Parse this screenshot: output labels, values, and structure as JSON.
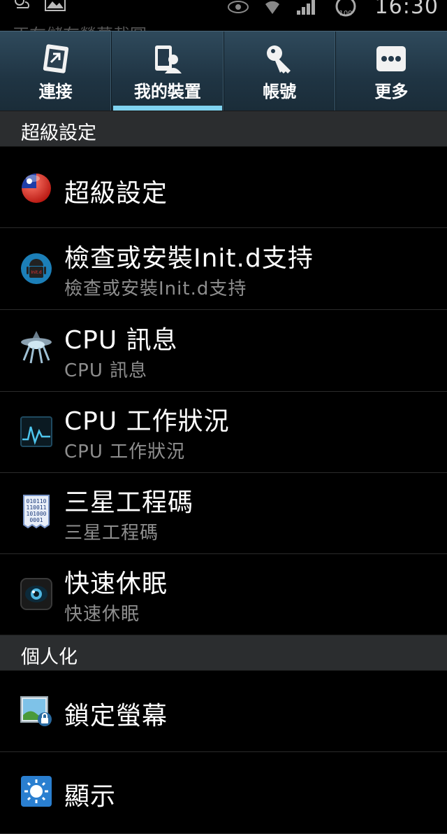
{
  "status": {
    "time": "16:30",
    "battery": "100",
    "notification_text": "正在儲存螢幕截圖"
  },
  "tabs": [
    {
      "label": "連接",
      "icon": "connections-icon",
      "active": false
    },
    {
      "label": "我的裝置",
      "icon": "my-device-icon",
      "active": true
    },
    {
      "label": "帳號",
      "icon": "accounts-key-icon",
      "active": false
    },
    {
      "label": "更多",
      "icon": "more-icon",
      "active": false
    }
  ],
  "sections": [
    {
      "header": "超級設定",
      "items": [
        {
          "title": "超級設定",
          "subtitle": "",
          "icon": "taiwan-flag-icon"
        },
        {
          "title": "檢查或安裝Init.d支持",
          "subtitle": "檢查或安裝Init.d支持",
          "icon": "android-robot-icon"
        },
        {
          "title": "CPU 訊息",
          "subtitle": "CPU 訊息",
          "icon": "cpu-info-icon"
        },
        {
          "title": "CPU 工作狀況",
          "subtitle": "CPU 工作狀況",
          "icon": "cpu-monitor-icon"
        },
        {
          "title": "三星工程碼",
          "subtitle": "三星工程碼",
          "icon": "binary-code-icon"
        },
        {
          "title": "快速休眠",
          "subtitle": "快速休眠",
          "icon": "quick-sleep-icon"
        }
      ]
    },
    {
      "header": "個人化",
      "items": [
        {
          "title": "鎖定螢幕",
          "subtitle": "",
          "icon": "lock-screen-icon"
        },
        {
          "title": "顯示",
          "subtitle": "",
          "icon": "display-icon"
        }
      ]
    }
  ],
  "colors": {
    "tab_active_underline": "#7fd3f0",
    "section_header_bg": "#2b2d2f",
    "subtitle": "#8e8e8e"
  }
}
